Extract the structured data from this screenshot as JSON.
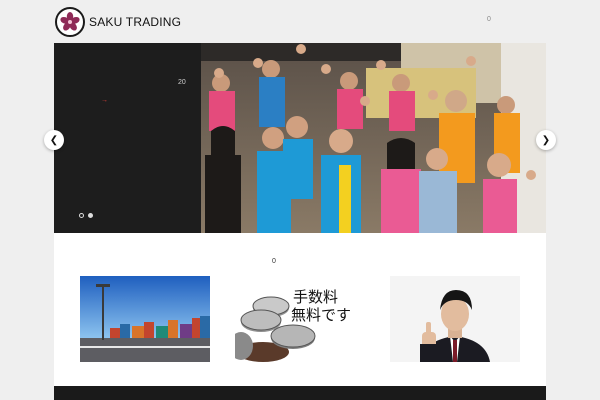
{
  "header": {
    "brand": "SAKU TRADING",
    "cart_count": "0"
  },
  "hero": {
    "slide_count": "20",
    "arrow": "→",
    "prev_icon": "❮",
    "next_icon": "❯"
  },
  "content": {
    "count": "0",
    "cards": [
      {
        "name": "shipping-port-image"
      },
      {
        "name": "coins-image",
        "text_line1": "手数料",
        "text_line2": "無料です"
      },
      {
        "name": "businessman-thumbs-up-image"
      }
    ]
  },
  "colors": {
    "accent": "#e0413a",
    "logo_flower": "#8e2a57",
    "footer": "#1a1a1a"
  }
}
